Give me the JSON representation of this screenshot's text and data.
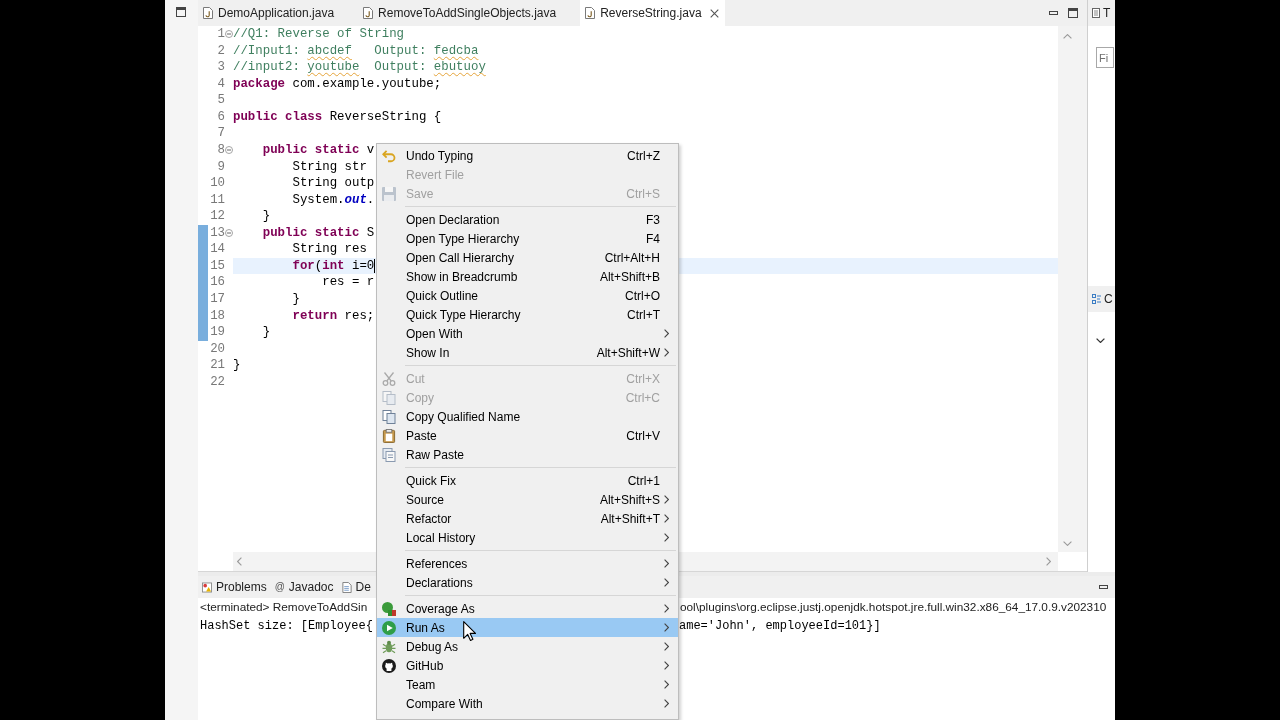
{
  "editor": {
    "tabs": [
      {
        "label": "DemoApplication.java",
        "selected": false
      },
      {
        "label": "RemoveToAddSingleObjects.java",
        "selected": false
      },
      {
        "label": "ReverseString.java",
        "selected": true
      }
    ],
    "lines": [
      {
        "number": "1",
        "collapsible": true,
        "changed": false,
        "current": false,
        "tokens": [
          {
            "kind": "comment",
            "text": "//Q1: Reverse of String"
          }
        ]
      },
      {
        "number": "2",
        "collapsible": false,
        "changed": false,
        "current": false,
        "tokens": [
          {
            "kind": "comment",
            "text": "//Input1: "
          },
          {
            "kind": "typo",
            "text": "abcdef"
          },
          {
            "kind": "comment",
            "text": "   Output: "
          },
          {
            "kind": "typo",
            "text": "fedcba"
          }
        ]
      },
      {
        "number": "3",
        "collapsible": false,
        "changed": false,
        "current": false,
        "tokens": [
          {
            "kind": "comment",
            "text": "//input2: "
          },
          {
            "kind": "typo",
            "text": "youtube"
          },
          {
            "kind": "comment",
            "text": "  Output: "
          },
          {
            "kind": "typo",
            "text": "ebutuoy"
          }
        ]
      },
      {
        "number": "4",
        "collapsible": false,
        "changed": false,
        "current": false,
        "tokens": [
          {
            "kind": "keyword",
            "text": "package"
          },
          {
            "kind": "plain",
            "text": " com.example.youtube;"
          }
        ]
      },
      {
        "number": "5",
        "collapsible": false,
        "changed": false,
        "current": false
      },
      {
        "number": "6",
        "collapsible": false,
        "changed": false,
        "current": false,
        "tokens": [
          {
            "kind": "keyword",
            "text": "public class"
          },
          {
            "kind": "plain",
            "text": " ReverseString {"
          }
        ]
      },
      {
        "number": "7",
        "collapsible": false,
        "changed": false,
        "current": false
      },
      {
        "number": "8",
        "collapsible": true,
        "changed": false,
        "current": false,
        "tokens": [
          {
            "kind": "keyword",
            "text": "    public static"
          },
          {
            "kind": "plain",
            "text": " v"
          }
        ]
      },
      {
        "number": "9",
        "collapsible": false,
        "changed": false,
        "current": false,
        "tokens": [
          {
            "kind": "plain",
            "text": "        String str"
          }
        ]
      },
      {
        "number": "10",
        "collapsible": false,
        "changed": false,
        "current": false,
        "tokens": [
          {
            "kind": "plain",
            "text": "        String outp"
          }
        ]
      },
      {
        "number": "11",
        "collapsible": false,
        "changed": false,
        "current": false,
        "tokens": [
          {
            "kind": "plain",
            "text": "        System."
          },
          {
            "kind": "field",
            "text": "out"
          },
          {
            "kind": "plain",
            "text": "."
          }
        ]
      },
      {
        "number": "12",
        "collapsible": false,
        "changed": false,
        "current": false,
        "tokens": [
          {
            "kind": "plain",
            "text": "    }"
          }
        ]
      },
      {
        "number": "13",
        "collapsible": true,
        "changed": true,
        "current": false,
        "tokens": [
          {
            "kind": "keyword",
            "text": "    public static"
          },
          {
            "kind": "plain",
            "text": " S"
          }
        ]
      },
      {
        "number": "14",
        "collapsible": false,
        "changed": true,
        "current": false,
        "tokens": [
          {
            "kind": "plain",
            "text": "        String res"
          }
        ]
      },
      {
        "number": "15",
        "collapsible": false,
        "changed": true,
        "current": true,
        "tokens": [
          {
            "kind": "keyword",
            "text": "        for"
          },
          {
            "kind": "plain",
            "text": "("
          },
          {
            "kind": "keyword",
            "text": "int"
          },
          {
            "kind": "plain",
            "text": " i=0"
          }
        ]
      },
      {
        "number": "16",
        "collapsible": false,
        "changed": true,
        "current": false,
        "tokens": [
          {
            "kind": "plain",
            "text": "            res = r"
          }
        ]
      },
      {
        "number": "17",
        "collapsible": false,
        "changed": true,
        "current": false,
        "tokens": [
          {
            "kind": "plain",
            "text": "        }"
          }
        ]
      },
      {
        "number": "18",
        "collapsible": false,
        "changed": true,
        "current": false,
        "tokens": [
          {
            "kind": "keyword",
            "text": "        return"
          },
          {
            "kind": "plain",
            "text": " res;"
          }
        ]
      },
      {
        "number": "19",
        "collapsible": false,
        "changed": true,
        "current": false,
        "tokens": [
          {
            "kind": "plain",
            "text": "    }"
          }
        ]
      },
      {
        "number": "20",
        "collapsible": false,
        "changed": false,
        "current": false
      },
      {
        "number": "21",
        "collapsible": false,
        "changed": false,
        "current": false,
        "tokens": [
          {
            "kind": "plain",
            "text": "}"
          }
        ]
      },
      {
        "number": "22",
        "collapsible": false,
        "changed": false,
        "current": false
      }
    ]
  },
  "context_menu": {
    "entries": [
      {
        "kind": "item",
        "label": "Undo Typing",
        "shortcut": "Ctrl+Z",
        "disabled": false,
        "submenu": false,
        "selected": false
      },
      {
        "kind": "item",
        "label": "Revert File",
        "disabled": true,
        "submenu": false,
        "selected": false
      },
      {
        "kind": "item",
        "label": "Save",
        "shortcut": "Ctrl+S",
        "disabled": true,
        "submenu": false,
        "selected": false
      },
      {
        "kind": "separator"
      },
      {
        "kind": "item",
        "label": "Open Declaration",
        "shortcut": "F3",
        "disabled": false,
        "submenu": false,
        "selected": false
      },
      {
        "kind": "item",
        "label": "Open Type Hierarchy",
        "shortcut": "F4",
        "disabled": false,
        "submenu": false,
        "selected": false
      },
      {
        "kind": "item",
        "label": "Open Call Hierarchy",
        "shortcut": "Ctrl+Alt+H",
        "disabled": false,
        "submenu": false,
        "selected": false
      },
      {
        "kind": "item",
        "label": "Show in Breadcrumb",
        "shortcut": "Alt+Shift+B",
        "disabled": false,
        "submenu": false,
        "selected": false
      },
      {
        "kind": "item",
        "label": "Quick Outline",
        "shortcut": "Ctrl+O",
        "disabled": false,
        "submenu": false,
        "selected": false
      },
      {
        "kind": "item",
        "label": "Quick Type Hierarchy",
        "shortcut": "Ctrl+T",
        "disabled": false,
        "submenu": false,
        "selected": false
      },
      {
        "kind": "item",
        "label": "Open With",
        "disabled": false,
        "submenu": true,
        "selected": false
      },
      {
        "kind": "item",
        "label": "Show In",
        "shortcut": "Alt+Shift+W",
        "disabled": false,
        "submenu": true,
        "selected": false
      },
      {
        "kind": "separator"
      },
      {
        "kind": "item",
        "label": "Cut",
        "shortcut": "Ctrl+X",
        "disabled": true,
        "submenu": false,
        "selected": false
      },
      {
        "kind": "item",
        "label": "Copy",
        "shortcut": "Ctrl+C",
        "disabled": true,
        "submenu": false,
        "selected": false
      },
      {
        "kind": "item",
        "label": "Copy Qualified Name",
        "disabled": false,
        "submenu": false,
        "selected": false
      },
      {
        "kind": "item",
        "label": "Paste",
        "shortcut": "Ctrl+V",
        "disabled": false,
        "submenu": false,
        "selected": false
      },
      {
        "kind": "item",
        "label": "Raw Paste",
        "disabled": false,
        "submenu": false,
        "selected": false
      },
      {
        "kind": "separator"
      },
      {
        "kind": "item",
        "label": "Quick Fix",
        "shortcut": "Ctrl+1",
        "disabled": false,
        "submenu": false,
        "selected": false
      },
      {
        "kind": "item",
        "label": "Source",
        "shortcut": "Alt+Shift+S",
        "disabled": false,
        "submenu": true,
        "selected": false
      },
      {
        "kind": "item",
        "label": "Refactor",
        "shortcut": "Alt+Shift+T",
        "disabled": false,
        "submenu": true,
        "selected": false
      },
      {
        "kind": "item",
        "label": "Local History",
        "disabled": false,
        "submenu": true,
        "selected": false
      },
      {
        "kind": "separator"
      },
      {
        "kind": "item",
        "label": "References",
        "disabled": false,
        "submenu": true,
        "selected": false
      },
      {
        "kind": "item",
        "label": "Declarations",
        "disabled": false,
        "submenu": true,
        "selected": false
      },
      {
        "kind": "separator"
      },
      {
        "kind": "item",
        "label": "Coverage As",
        "disabled": false,
        "submenu": true,
        "selected": false
      },
      {
        "kind": "item",
        "label": "Run As",
        "disabled": false,
        "submenu": true,
        "selected": true
      },
      {
        "kind": "item",
        "label": "Debug As",
        "disabled": false,
        "submenu": true,
        "selected": false
      },
      {
        "kind": "item",
        "label": "GitHub",
        "disabled": false,
        "submenu": true,
        "selected": false
      },
      {
        "kind": "item",
        "label": "Team",
        "disabled": false,
        "submenu": true,
        "selected": false
      },
      {
        "kind": "item",
        "label": "Compare With",
        "disabled": false,
        "submenu": true,
        "selected": false
      }
    ]
  },
  "right_panel": {
    "tab_label": "T",
    "filter": {
      "placeholder": "Fi"
    },
    "outline_tab_label": "C"
  },
  "bottom_panel": {
    "tabs": [
      {
        "label": "Problems",
        "selected": false
      },
      {
        "label": "Javadoc",
        "glyph": "@",
        "selected": false
      },
      {
        "label": "De",
        "selected": false
      }
    ],
    "console_header": [
      "<terminated> RemoveToAddSin",
      "ool\\plugins\\org.eclipse.justj.openjdk.hotspot.jre.full.win32.x86_64_17.0.9.v202310"
    ],
    "console_output": [
      "HashSet size: [Employee{",
      "ame='John', employeeId=101}]"
    ]
  }
}
